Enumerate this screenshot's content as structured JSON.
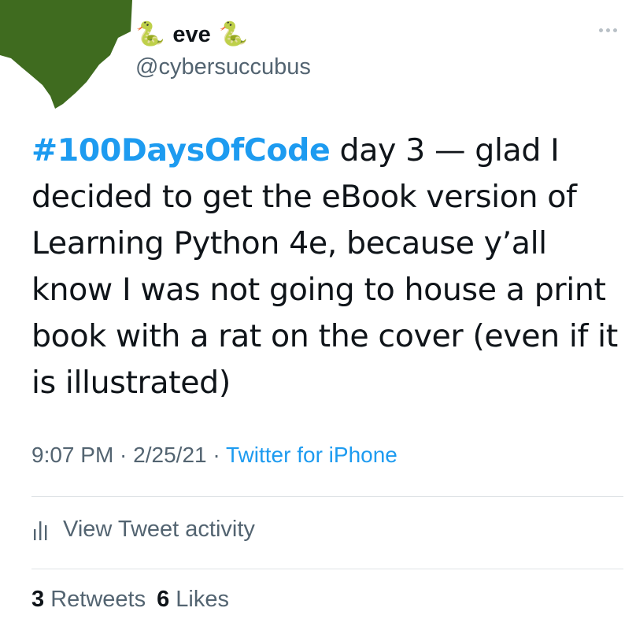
{
  "user": {
    "display_name": "eve",
    "emoji_left": "🐍",
    "emoji_right": "🐍",
    "handle": "@cybersuccubus",
    "avatar_color": "#3f6b1f"
  },
  "more_icon": "more-horizontal-icon",
  "tweet": {
    "hashtag": "#100DaysOfCode",
    "body": " day 3 — glad I decided to get the eBook version of Learning Python 4e, because y’all know I was not going to house a print book with a rat on the cover (even if it is illustrated)"
  },
  "meta": {
    "time": "9:07 PM",
    "separator1": " · ",
    "date": "2/25/21",
    "separator2": " · ",
    "source": "Twitter for iPhone"
  },
  "activity": {
    "icon": "bar-chart-icon",
    "label": "View Tweet activity"
  },
  "stats": {
    "retweets_count": "3",
    "retweets_label": "Retweets",
    "likes_count": "6",
    "likes_label": "Likes"
  },
  "colors": {
    "link": "#1d9bf0",
    "secondary_text": "#536471",
    "primary_text": "#0f1419",
    "divider": "#dfe3e6"
  }
}
